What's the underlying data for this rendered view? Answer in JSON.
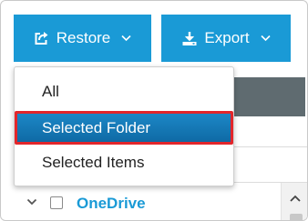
{
  "toolbar": {
    "restore_label": "Restore",
    "export_label": "Export",
    "restore_icon": "share-arrow-icon",
    "export_icon": "download-icon"
  },
  "restore_menu": {
    "items": [
      {
        "label": "All",
        "selected": false
      },
      {
        "label": "Selected Folder",
        "selected": true
      },
      {
        "label": "Selected Items",
        "selected": false
      }
    ]
  },
  "tree": {
    "root_label": "OneDrive",
    "root_expanded": true,
    "root_checked": false
  },
  "colors": {
    "accent": "#1a9ad6",
    "selected_item": "#1878b8",
    "highlight_border": "#e2262b",
    "header_bar": "#5f6b70"
  }
}
